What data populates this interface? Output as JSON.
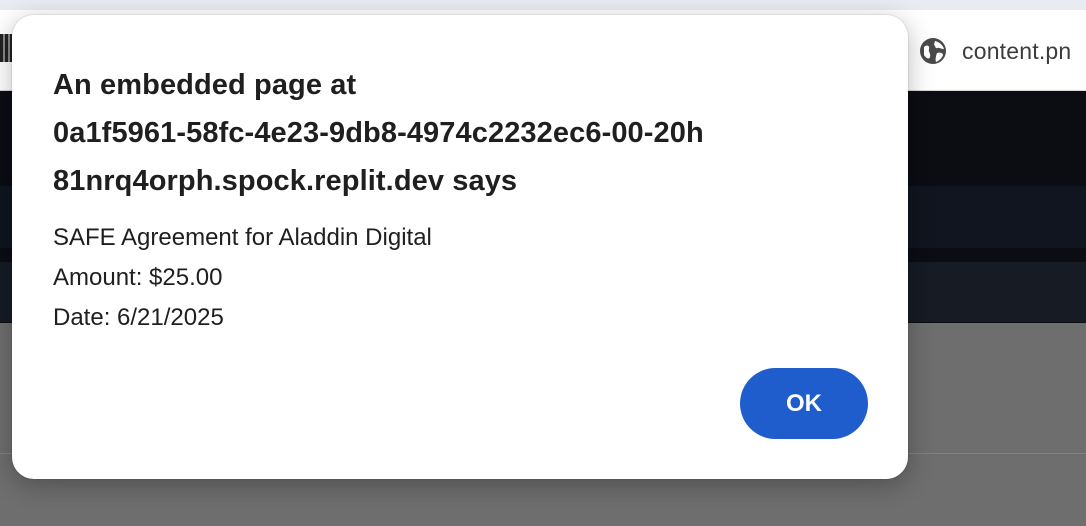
{
  "browser": {
    "address_text": "content.pn",
    "address_icon": "globe-icon"
  },
  "dialog": {
    "title_lines": [
      "An embedded page at",
      "0a1f5961-58fc-4e23-9db8-4974c2232ec6-00-20h",
      "81nrq4orph.spock.replit.dev says"
    ],
    "message_lines": [
      "SAFE Agreement for Aladdin Digital",
      "Amount: $25.00",
      "Date: 6/21/2025"
    ],
    "ok_label": "OK"
  },
  "colors": {
    "button_blue": "#1f5ccc",
    "dim_overlay": "#6e6e6e",
    "dark_page": "#0b0d13"
  }
}
